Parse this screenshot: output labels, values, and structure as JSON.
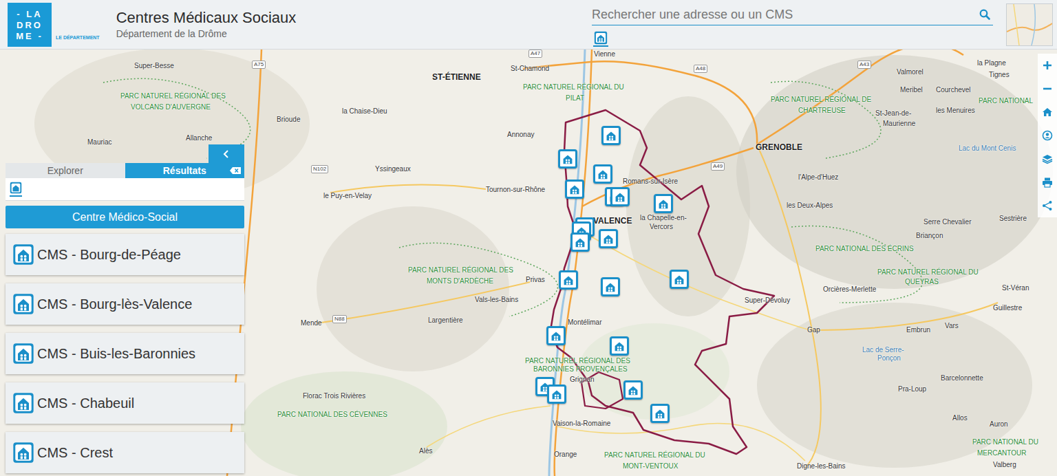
{
  "header": {
    "logo": {
      "lines": [
        "- LA",
        "DRO",
        "ME -"
      ],
      "tagline": "LE DÉPARTEMENT"
    },
    "title": "Centres Médicaux Sociaux",
    "subtitle": "Département de la Drôme"
  },
  "search": {
    "placeholder": "Rechercher une adresse ou un CMS"
  },
  "panel": {
    "tabs": [
      {
        "label": "Explorer",
        "selected": false
      },
      {
        "label": "Résultats",
        "selected": true
      }
    ],
    "group": "Centre Médico-Social",
    "results": [
      {
        "label": "CMS - Bourg-de-Péage"
      },
      {
        "label": "CMS - Bourg-lès-Valence"
      },
      {
        "label": "CMS - Buis-les-Baronnies"
      },
      {
        "label": "CMS - Chabeuil"
      },
      {
        "label": "CMS - Crest"
      }
    ]
  },
  "map": {
    "labels": [
      {
        "text": "Super-Besse",
        "kind": "city"
      },
      {
        "text": "PARC NATUREL RÉGIONAL DES",
        "kind": "park"
      },
      {
        "text": "VOLCANS D'AUVERGNE",
        "kind": "park"
      },
      {
        "text": "Brioude",
        "kind": "city"
      },
      {
        "text": "la Chaise-Dieu",
        "kind": "city"
      },
      {
        "text": "Allanche",
        "kind": "city"
      },
      {
        "text": "Mauriac",
        "kind": "city"
      },
      {
        "text": "Yssingeaux",
        "kind": "city"
      },
      {
        "text": "le Puy-en-Velay",
        "kind": "city"
      },
      {
        "text": "ST-ÉTIENNE",
        "kind": "major"
      },
      {
        "text": "St-Chamond",
        "kind": "city"
      },
      {
        "text": "Vienne",
        "kind": "city"
      },
      {
        "text": "PARC NATUREL RÉGIONAL DU",
        "kind": "park"
      },
      {
        "text": "PILAT",
        "kind": "park"
      },
      {
        "text": "Annonay",
        "kind": "city"
      },
      {
        "text": "Tournon-sur-Rhône",
        "kind": "city"
      },
      {
        "text": "Romans-sur-Isère",
        "kind": "city"
      },
      {
        "text": "VALENCE",
        "kind": "major"
      },
      {
        "text": "la Chapelle-en-",
        "kind": "city"
      },
      {
        "text": "Vercors",
        "kind": "city"
      },
      {
        "text": "PARC NATUREL RÉGIONAL DES",
        "kind": "park"
      },
      {
        "text": "MONTS D'ARDÈCHE",
        "kind": "park"
      },
      {
        "text": "Privas",
        "kind": "city"
      },
      {
        "text": "Vals-les-Bains",
        "kind": "city"
      },
      {
        "text": "Montélimar",
        "kind": "city"
      },
      {
        "text": "Largentière",
        "kind": "city"
      },
      {
        "text": "Mende",
        "kind": "city"
      },
      {
        "text": "PARC NATUREL RÉGIONAL DES",
        "kind": "park"
      },
      {
        "text": "BARONNIES PROVENÇALES",
        "kind": "park"
      },
      {
        "text": "Grignan",
        "kind": "city"
      },
      {
        "text": "Vaison-la-Romaine",
        "kind": "city"
      },
      {
        "text": "Orange",
        "kind": "city"
      },
      {
        "text": "Alès",
        "kind": "city"
      },
      {
        "text": "Florac Trois Rivières",
        "kind": "city"
      },
      {
        "text": "PARC NATIONAL DES CÉVENNES",
        "kind": "park"
      },
      {
        "text": "PARC NATUREL RÉGIONAL DU",
        "kind": "park"
      },
      {
        "text": "MONT-VENTOUX",
        "kind": "park"
      },
      {
        "text": "GRENOBLE",
        "kind": "major"
      },
      {
        "text": "l'Alpe-d'Huez",
        "kind": "city"
      },
      {
        "text": "les Deux-Alpes",
        "kind": "city"
      },
      {
        "text": "PARC NATIONAL DES ÉCRINS",
        "kind": "park"
      },
      {
        "text": "Serre Chevalier",
        "kind": "city"
      },
      {
        "text": "Sestrière",
        "kind": "city"
      },
      {
        "text": "Briançon",
        "kind": "city"
      },
      {
        "text": "PARC NATUREL RÉGIONAL DU",
        "kind": "park"
      },
      {
        "text": "QUEYRAS",
        "kind": "park"
      },
      {
        "text": "Orcières-Merlette",
        "kind": "city"
      },
      {
        "text": "St-Véran",
        "kind": "city"
      },
      {
        "text": "Super-Dévoluy",
        "kind": "city"
      },
      {
        "text": "Guillestre",
        "kind": "city"
      },
      {
        "text": "Vars",
        "kind": "city"
      },
      {
        "text": "Gap",
        "kind": "city"
      },
      {
        "text": "Embrun",
        "kind": "city"
      },
      {
        "text": "Lac de Serre-",
        "kind": "lake"
      },
      {
        "text": "Ponçon",
        "kind": "lake"
      },
      {
        "text": "Barcelonnette",
        "kind": "city"
      },
      {
        "text": "Pra-Loup",
        "kind": "city"
      },
      {
        "text": "Allos",
        "kind": "city"
      },
      {
        "text": "Auron",
        "kind": "city"
      },
      {
        "text": "PARC NATIONAL DU",
        "kind": "park"
      },
      {
        "text": "MERCANTOUR",
        "kind": "park"
      },
      {
        "text": "Valberg",
        "kind": "city"
      },
      {
        "text": "Digne-les-Bains",
        "kind": "city"
      },
      {
        "text": "Valmorel",
        "kind": "city"
      },
      {
        "text": "la Plagne",
        "kind": "city"
      },
      {
        "text": "Tignes",
        "kind": "city"
      },
      {
        "text": "Meribel",
        "kind": "city"
      },
      {
        "text": "Courchevel",
        "kind": "city"
      },
      {
        "text": "PARC NATUREL RÉGIONAL DE",
        "kind": "park"
      },
      {
        "text": "CHARTREUSE",
        "kind": "park"
      },
      {
        "text": "St-Jean-de-",
        "kind": "city"
      },
      {
        "text": "Maurienne",
        "kind": "city"
      },
      {
        "text": "les Menuires",
        "kind": "city"
      },
      {
        "text": "Lac du Mont Cenis",
        "kind": "lake"
      },
      {
        "text": "PARC NATIONAL",
        "kind": "park"
      }
    ],
    "roads": [
      "A75",
      "N102",
      "N88",
      "A48",
      "A49",
      "A43",
      "A47"
    ]
  }
}
